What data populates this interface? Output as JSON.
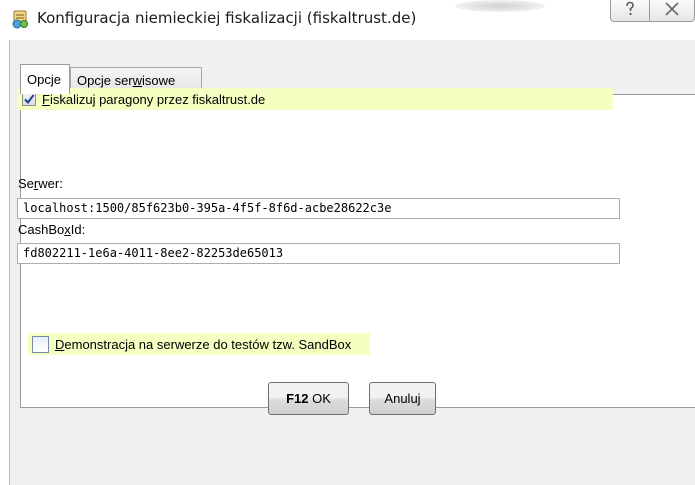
{
  "window": {
    "title": "Konfiguracja niemieckiej fiskalizacji (fiskaltrust.de)"
  },
  "tabs": [
    {
      "label": "Opcje",
      "active": true
    },
    {
      "label_pre": "Opcje ser",
      "label_u": "w",
      "label_post": "isowe",
      "active": false
    }
  ],
  "fiscalize": {
    "label_u": "F",
    "label_rest": "iskalizuj paragony przez fiskaltrust.de",
    "checked": true
  },
  "server": {
    "label_pre": "Se",
    "label_u": "r",
    "label_post": "wer:",
    "value": "localhost:1500/85f623b0-395a-4f5f-8f6d-acbe28622c3e"
  },
  "cashbox": {
    "label_pre": "CashBo",
    "label_u": "x",
    "label_post": "Id:",
    "value": "fd802211-1e6a-4011-8ee2-82253de65013"
  },
  "sandbox": {
    "label_u": "D",
    "label_rest": "emonstracja na serwerze do testów tzw. SandBox",
    "checked": false
  },
  "buttons": {
    "ok_key": "F12",
    "ok_label": "OK",
    "cancel_label": "Anuluj"
  },
  "colors": {
    "highlight_row": "#f5ffc2",
    "panel": "#ffffff",
    "dialog_bg": "#f0f0f0"
  },
  "icons": {
    "app": "receipt-app-icon",
    "help": "help-icon",
    "close": "close-icon",
    "check": "checkmark-icon"
  }
}
